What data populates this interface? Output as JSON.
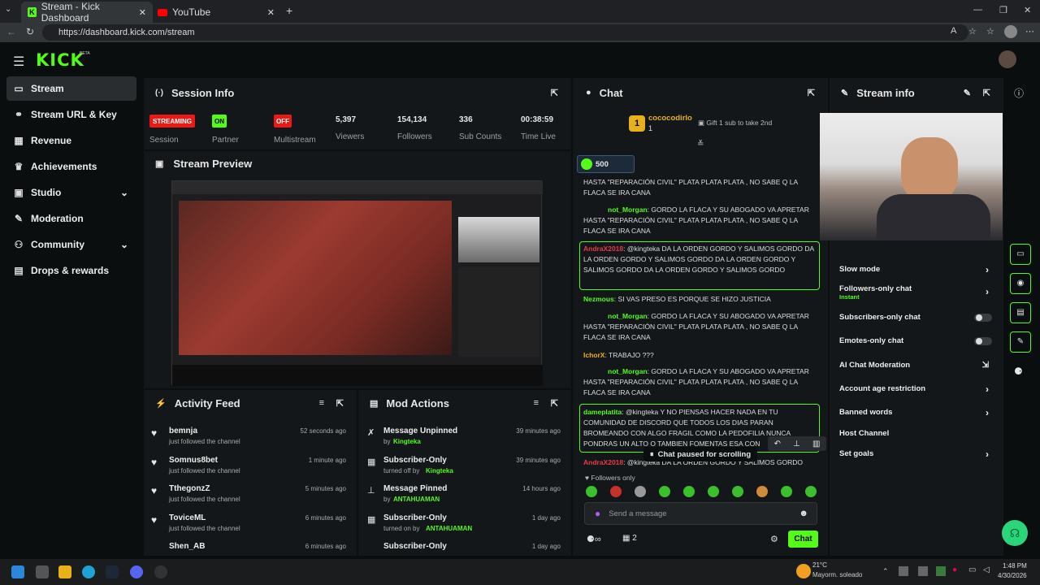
{
  "browser": {
    "tabs": [
      {
        "title": "Stream - Kick Dashboard"
      },
      {
        "title": "YouTube"
      }
    ],
    "url": "https://dashboard.kick.com/stream"
  },
  "brand": {
    "logo": "KICK",
    "beta": "BETA",
    "accent": "#53fc18"
  },
  "sidebar": {
    "items": [
      {
        "label": "Stream",
        "icon": "broadcast-icon",
        "active": true
      },
      {
        "label": "Stream URL & Key",
        "icon": "link-icon"
      },
      {
        "label": "Revenue",
        "icon": "chart-icon"
      },
      {
        "label": "Achievements",
        "icon": "trophy-icon"
      },
      {
        "label": "Studio",
        "icon": "studio-icon"
      },
      {
        "label": "Moderation",
        "icon": "wrench-icon"
      },
      {
        "label": "Community",
        "icon": "people-icon"
      },
      {
        "label": "Drops & rewards",
        "icon": "gift-icon"
      }
    ]
  },
  "session": {
    "title": "Session Info",
    "session_badge": "STREAMING",
    "session_label": "Session",
    "partner_badge": "ON",
    "partner_label": "Partner",
    "multistream_badge": "OFF",
    "multistream_label": "Multistream",
    "viewers": "5,397",
    "viewers_label": "Viewers",
    "followers": "154,134",
    "followers_label": "Followers",
    "subs": "336",
    "subs_label": "Sub Counts",
    "time": "00:38:59",
    "time_label": "Time Live"
  },
  "preview": {
    "title": "Stream Preview"
  },
  "activity": {
    "title": "Activity Feed",
    "items": [
      {
        "name": "bemnja",
        "action": "just followed the channel",
        "time": "52 seconds ago"
      },
      {
        "name": "Somnus8bet",
        "action": "just followed the channel",
        "time": "1 minute ago"
      },
      {
        "name": "TthegonzZ",
        "action": "just followed the channel",
        "time": "5 minutes ago"
      },
      {
        "name": "ToviceML",
        "action": "just followed the channel",
        "time": "6 minutes ago"
      },
      {
        "name": "Shen_AB",
        "action": "",
        "time": "6 minutes ago"
      }
    ]
  },
  "mod": {
    "title": "Mod Actions",
    "items": [
      {
        "title": "Message Unpinned",
        "by": "by",
        "who": "Kingteka",
        "time": "39 minutes ago"
      },
      {
        "title": "Subscriber-Only",
        "by": "turned off by",
        "who": "Kingteka",
        "time": "39 minutes ago"
      },
      {
        "title": "Message Pinned",
        "by": "by",
        "who": "ANTAHUAMAN",
        "time": "14 hours ago"
      },
      {
        "title": "Subscriber-Only",
        "by": "turned on by",
        "who": "ANTAHUAMAN",
        "time": "1 day ago"
      },
      {
        "title": "Subscriber-Only",
        "by": "",
        "who": "",
        "time": "1 day ago"
      }
    ]
  },
  "chat": {
    "title": "Chat",
    "top_gifter": "cococodirlo",
    "top_gifter_count": "1",
    "gift_hint": "Gift 1 sub to take 2nd",
    "badge_count": "500",
    "messages": [
      {
        "user": "",
        "text": "HASTA \"REPARACIÓN CIVIL\" PLATA PLATA PLATA , NO SABE Q LA FLACA SE IRA CANA"
      },
      {
        "user": "not_Morgan",
        "text": ": GORDO LA FLACA Y SU ABOGADO VA APRETAR HASTA \"REPARACIÓN CIVIL\" PLATA PLATA PLATA , NO SABE Q LA FLACA SE IRA CANA"
      },
      {
        "user": "AndraX2018",
        "text": ": @kingteka DA LA ORDEN GORDO Y SALIMOS GORDO DA LA ORDEN GORDO Y SALIMOS GORDO DA LA ORDEN GORDO Y SALIMOS GORDO DA LA ORDEN GORDO Y SALIMOS GORDO"
      },
      {
        "user": "Nezmous",
        "text": ": SI VAS PRESO ES PORQUE SE HIZO JUSTICIA"
      },
      {
        "user": "not_Morgan",
        "text": ": GORDO LA FLACA Y SU ABOGADO VA APRETAR HASTA \"REPARACIÓN CIVIL\" PLATA PLATA PLATA , NO SABE Q LA FLACA SE IRA CANA"
      },
      {
        "user": "IchorX",
        "text": ": TRABAJO ???"
      },
      {
        "user": "not_Morgan",
        "text": ": GORDO LA FLACA Y SU ABOGADO VA APRETAR HASTA \"REPARACIÓN CIVIL\" PLATA PLATA PLATA , NO SABE Q LA FLACA SE IRA CANA"
      },
      {
        "user": "dameplatita",
        "text": ": @kingteka Y NO PIENSAS HACER NADA EN TU COMUNIDAD DE DISCORD QUE TODOS LOS DIAS PARAN BROMEANDO CON ALGO FRAGIL COMO LA PEDOFILIA NUNCA PONDRAS UN ALTO O TAMBIEN FOMENTAS ESA CON"
      },
      {
        "user": "AndraX2018",
        "text": ": @kingteka DA LA ORDEN GORDO Y SALIMOS GORDO"
      }
    ],
    "paused": "Chat paused for scrolling",
    "followers_only": "Followers only",
    "input_placeholder": "Send a message",
    "count": "2",
    "send": "Chat"
  },
  "stream_info": {
    "title": "Stream info",
    "settings": [
      {
        "label": "Slow mode",
        "control": "chevron"
      },
      {
        "label": "Followers-only chat",
        "sub": "Instant",
        "control": "chevron"
      },
      {
        "label": "Subscribers-only chat",
        "control": "toggle"
      },
      {
        "label": "Emotes-only chat",
        "control": "toggle"
      },
      {
        "label": "AI Chat Moderation",
        "control": "external"
      },
      {
        "label": "Account age restriction",
        "control": "chevron"
      },
      {
        "label": "Banned words",
        "control": "chevron"
      },
      {
        "label": "Host Channel",
        "control": "none"
      },
      {
        "label": "Set goals",
        "control": "chevron"
      }
    ]
  },
  "taskbar": {
    "temp": "21°C",
    "weather": "Mayorm. soleado",
    "time": "1:48 PM",
    "date": "4/30/2026"
  }
}
